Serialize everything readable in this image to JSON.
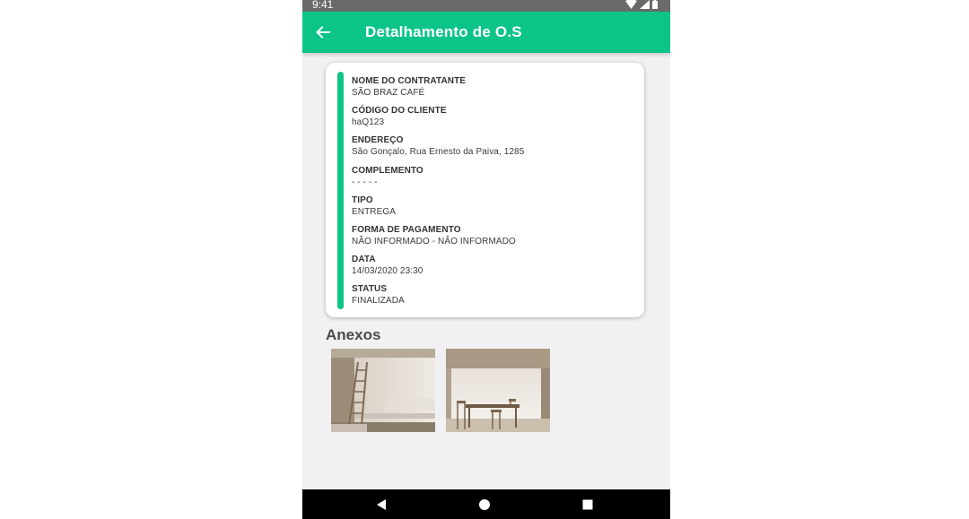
{
  "status_bar": {
    "time": "9:41"
  },
  "app_bar": {
    "title": "Detalhamento de O.S",
    "back_icon": "arrow-left-icon",
    "color": "#0cc487"
  },
  "details": {
    "fields": [
      {
        "label": "NOME DO CONTRATANTE",
        "value": "SÃO BRAZ CAFÉ"
      },
      {
        "label": "CÓDIGO DO CLIENTE",
        "value": "haQ123"
      },
      {
        "label": "ENDEREÇO",
        "value": "São Gonçalo, Rua Ernesto da Paiva, 1285"
      },
      {
        "label": "COMPLEMENTO",
        "value": "- - - - -"
      },
      {
        "label": "TIPO",
        "value": "ENTREGA"
      },
      {
        "label": "FORMA DE PAGAMENTO",
        "value": "NÃO INFORMADO - NÃO INFORMADO"
      },
      {
        "label": "DATA",
        "value": "14/03/2020 23:30"
      },
      {
        "label": "STATUS",
        "value": "FINALIZADA"
      }
    ]
  },
  "attachments": {
    "title": "Anexos",
    "items": [
      "room-photo-ladder",
      "room-photo-dining-table"
    ]
  },
  "nav_bar": {
    "icons": [
      "nav-back-icon",
      "nav-home-icon",
      "nav-recents-icon"
    ]
  }
}
